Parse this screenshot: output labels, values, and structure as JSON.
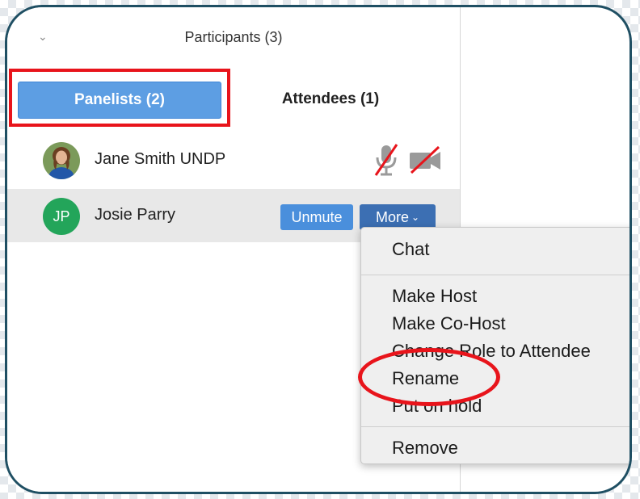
{
  "panel": {
    "title": "Participants (3)",
    "tabs": {
      "panelists": "Panelists (2)",
      "attendees": "Attendees (1)"
    }
  },
  "participants": [
    {
      "name": "Jane Smith UNDP",
      "avatar": "photo",
      "mic": "muted",
      "video": "off"
    },
    {
      "name": "Josie Parry",
      "avatar_initials": "JP",
      "avatar_color": "#23a55a"
    }
  ],
  "row_actions": {
    "unmute": "Unmute",
    "more": "More"
  },
  "menu": {
    "items": [
      "Chat",
      "Make Host",
      "Make Co-Host",
      "Change Role to Attendee",
      "Rename",
      "Put on hold",
      "Remove"
    ]
  },
  "colors": {
    "highlight": "#e8141b",
    "panelists_tab": "#5d9ee3",
    "unmute_button": "#4a8fdc",
    "more_button": "#3c6fb3",
    "frame_border": "#1f4f63"
  },
  "icons": [
    "chevron-down-icon",
    "mic-muted-icon",
    "video-off-icon",
    "chevron-down-icon"
  ]
}
